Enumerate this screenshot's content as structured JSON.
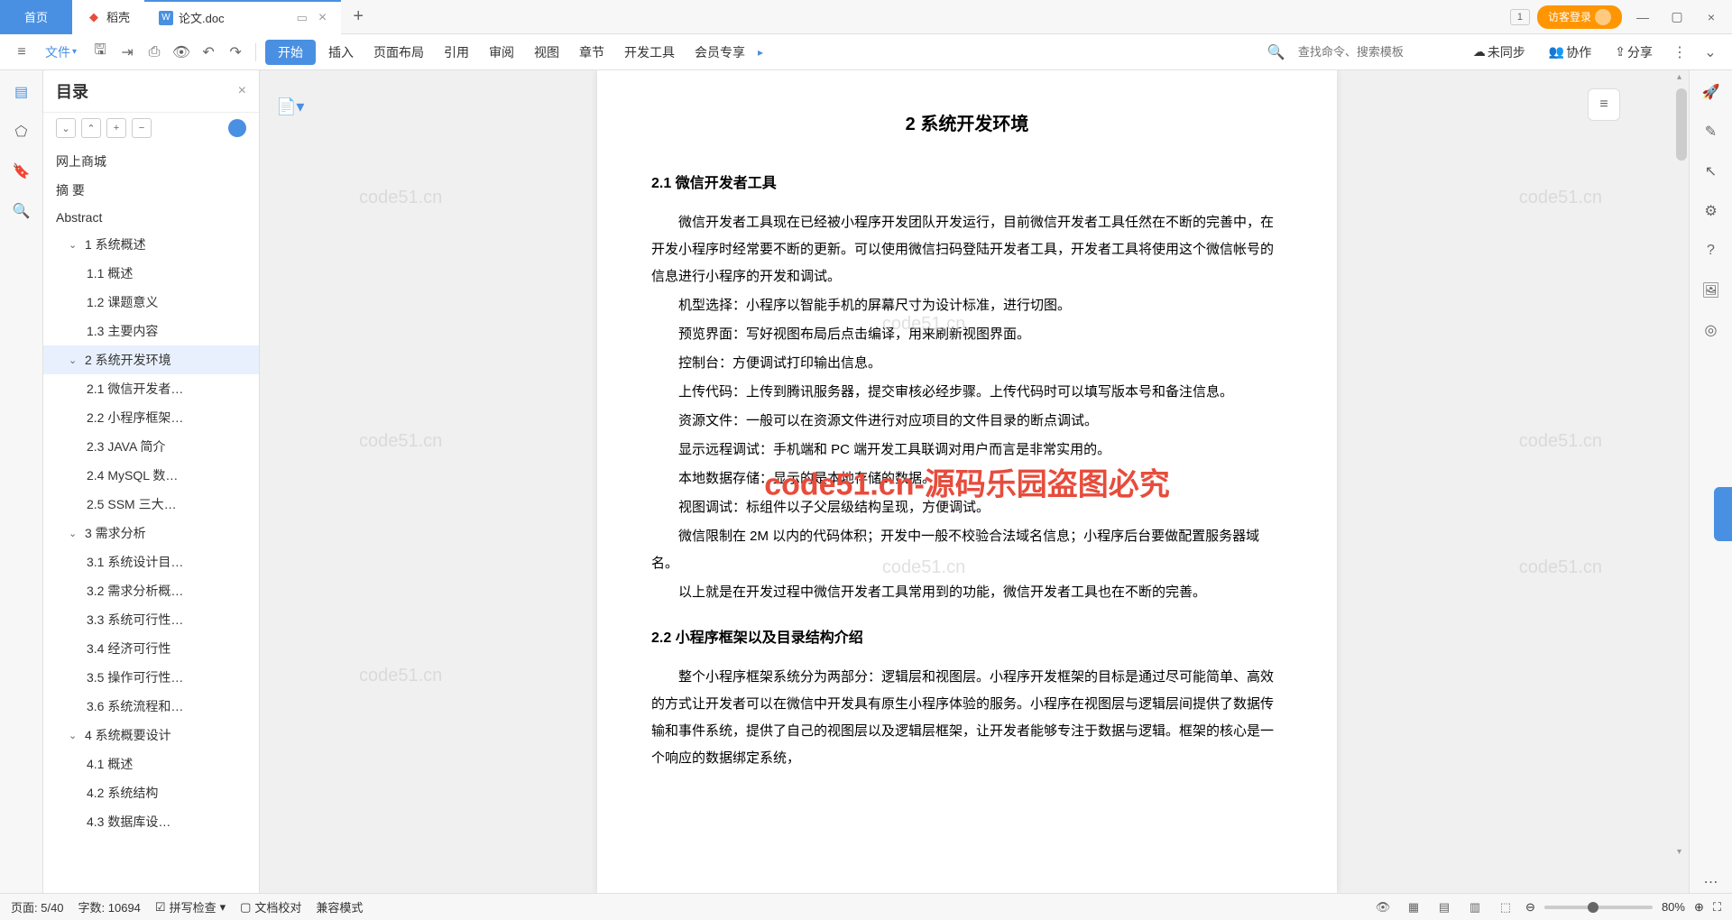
{
  "tabs": {
    "home": "首页",
    "docke": "稻壳",
    "doc": "论文.doc"
  },
  "login": "访客登录",
  "toolbar": {
    "menu": "≡",
    "file": "文件",
    "start": "开始",
    "insert": "插入",
    "layout": "页面布局",
    "ref": "引用",
    "review": "审阅",
    "view": "视图",
    "chapter": "章节",
    "devtool": "开发工具",
    "member": "会员专享",
    "search_ph": "查找命令、搜索模板",
    "unsync": "未同步",
    "coop": "协作",
    "share": "分享"
  },
  "sidebar": {
    "title": "目录"
  },
  "toc": [
    {
      "t": "网上商城",
      "l": 1
    },
    {
      "t": "摘 要",
      "l": 1
    },
    {
      "t": "Abstract",
      "l": 1
    },
    {
      "t": "1  系统概述",
      "l": 2,
      "c": true
    },
    {
      "t": "1.1 概述",
      "l": 3
    },
    {
      "t": "1.2 课题意义",
      "l": 3
    },
    {
      "t": "1.3 主要内容",
      "l": 3
    },
    {
      "t": "2  系统开发环境",
      "l": 2,
      "c": true,
      "a": true
    },
    {
      "t": "2.1 微信开发者…",
      "l": 3
    },
    {
      "t": "2.2 小程序框架…",
      "l": 3
    },
    {
      "t": "2.3 JAVA 简介",
      "l": 3
    },
    {
      "t": "2.4 MySQL 数…",
      "l": 3
    },
    {
      "t": "2.5 SSM 三大…",
      "l": 3
    },
    {
      "t": "3  需求分析",
      "l": 2,
      "c": true
    },
    {
      "t": "3.1 系统设计目…",
      "l": 3
    },
    {
      "t": "3.2 需求分析概…",
      "l": 3
    },
    {
      "t": "3.3 系统可行性…",
      "l": 3
    },
    {
      "t": "3.4 经济可行性",
      "l": 3
    },
    {
      "t": "3.5 操作可行性…",
      "l": 3
    },
    {
      "t": "3.6 系统流程和…",
      "l": 3
    },
    {
      "t": "4 系统概要设计",
      "l": 2,
      "c": true
    },
    {
      "t": "4.1 概述",
      "l": 3
    },
    {
      "t": "4.2 系统结构",
      "l": 3
    },
    {
      "t": "4.3 数据库设…",
      "l": 3
    }
  ],
  "doc": {
    "h1": "2  系统开发环境",
    "h21": "2.1 微信开发者工具",
    "p1": "微信开发者工具现在已经被小程序开发团队开发运行，目前微信开发者工具任然在不断的完善中，在开发小程序时经常要不断的更新。可以使用微信扫码登陆开发者工具，开发者工具将使用这个微信帐号的信息进行小程序的开发和调试。",
    "p2": "机型选择：小程序以智能手机的屏幕尺寸为设计标准，进行切图。",
    "p3": "预览界面：写好视图布局后点击编译，用来刷新视图界面。",
    "p4": "控制台：方便调试打印输出信息。",
    "p5": "上传代码：上传到腾讯服务器，提交审核必经步骤。上传代码时可以填写版本号和备注信息。",
    "p6": "资源文件：一般可以在资源文件进行对应项目的文件目录的断点调试。",
    "p7": "显示远程调试：手机端和 PC 端开发工具联调对用户而言是非常实用的。",
    "p8": "本地数据存储：显示的是本地存储的数据。",
    "p9": "视图调试：标组件以子父层级结构呈现，方便调试。",
    "p10": "微信限制在 2M 以内的代码体积；开发中一般不校验合法域名信息；小程序后台要做配置服务器域名。",
    "p11": "以上就是在开发过程中微信开发者工具常用到的功能，微信开发者工具也在不断的完善。",
    "h22": "2.2 小程序框架以及目录结构介绍",
    "p12": "整个小程序框架系统分为两部分：逻辑层和视图层。小程序开发框架的目标是通过尽可能简单、高效的方式让开发者可以在微信中开发具有原生小程序体验的服务。小程序在视图层与逻辑层间提供了数据传输和事件系统，提供了自己的视图层以及逻辑层框架，让开发者能够专注于数据与逻辑。框架的核心是一个响应的数据绑定系统，"
  },
  "wm_red": "code51.cn-源码乐园盗图必究",
  "wm": "code51.cn",
  "status": {
    "page": "页面: 5/40",
    "words": "字数: 10694",
    "spell": "拼写检查",
    "proof": "文档校对",
    "compat": "兼容模式",
    "zoom": "80%"
  }
}
